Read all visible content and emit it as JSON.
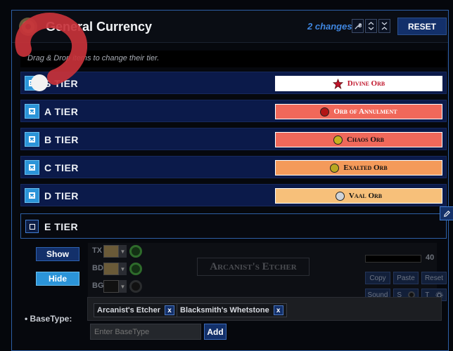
{
  "header": {
    "title": "General Currency",
    "changes": "2 changes",
    "reset_label": "RESET",
    "icons": [
      "wrench-icon",
      "chevron-up-down-icon",
      "collapse-icon"
    ]
  },
  "hint": "Drag & Drop items to change their tier.",
  "tiers": [
    {
      "label": "S TIER",
      "checked": true,
      "item": "Divine Orb",
      "item_bg": "#ffffff",
      "item_color": "#c0142a",
      "orb_color": "#c0142a"
    },
    {
      "label": "A TIER",
      "checked": true,
      "item": "Orb of Annulment",
      "item_bg": "#f0685a",
      "item_color": "#ffffff",
      "orb_color": "#b31515"
    },
    {
      "label": "B TIER",
      "checked": true,
      "item": "Chaos Orb",
      "item_bg": "#f0685a",
      "item_color": "#111111",
      "orb_color": "#c7b21e"
    },
    {
      "label": "C TIER",
      "checked": true,
      "item": "Exalted Orb",
      "item_bg": "#f49a5a",
      "item_color": "#111111",
      "orb_color": "#b9a820"
    },
    {
      "label": "D TIER",
      "checked": true,
      "item": "Vaal Orb",
      "item_bg": "#f7c07a",
      "item_color": "#111111",
      "orb_color": "#cfd3d8"
    }
  ],
  "e_tier": {
    "label": "E TIER",
    "checked": false,
    "show_label": "Show",
    "hide_label": "Hide",
    "style_labels": {
      "tx": "TX",
      "bd": "BD",
      "bg": "BG"
    },
    "preview_text": "Arcanist's Etcher",
    "opacity_value": "40",
    "copy_label": "Copy",
    "paste_label": "Paste",
    "reset_label": "Reset",
    "sound_label": "Sound",
    "s_label": "S",
    "t_label": "T"
  },
  "basetype": {
    "label": "• BaseType:",
    "chips": [
      "Arcanist's Etcher",
      "Blacksmith's Whetstone"
    ],
    "chip_remove": "x",
    "placeholder": "Enter BaseType",
    "add_label": "Add"
  },
  "colors": {
    "accent": "#2b94d8",
    "tier_row_bg": "#0b1a4a",
    "panel_border": "#2d5fa6"
  }
}
